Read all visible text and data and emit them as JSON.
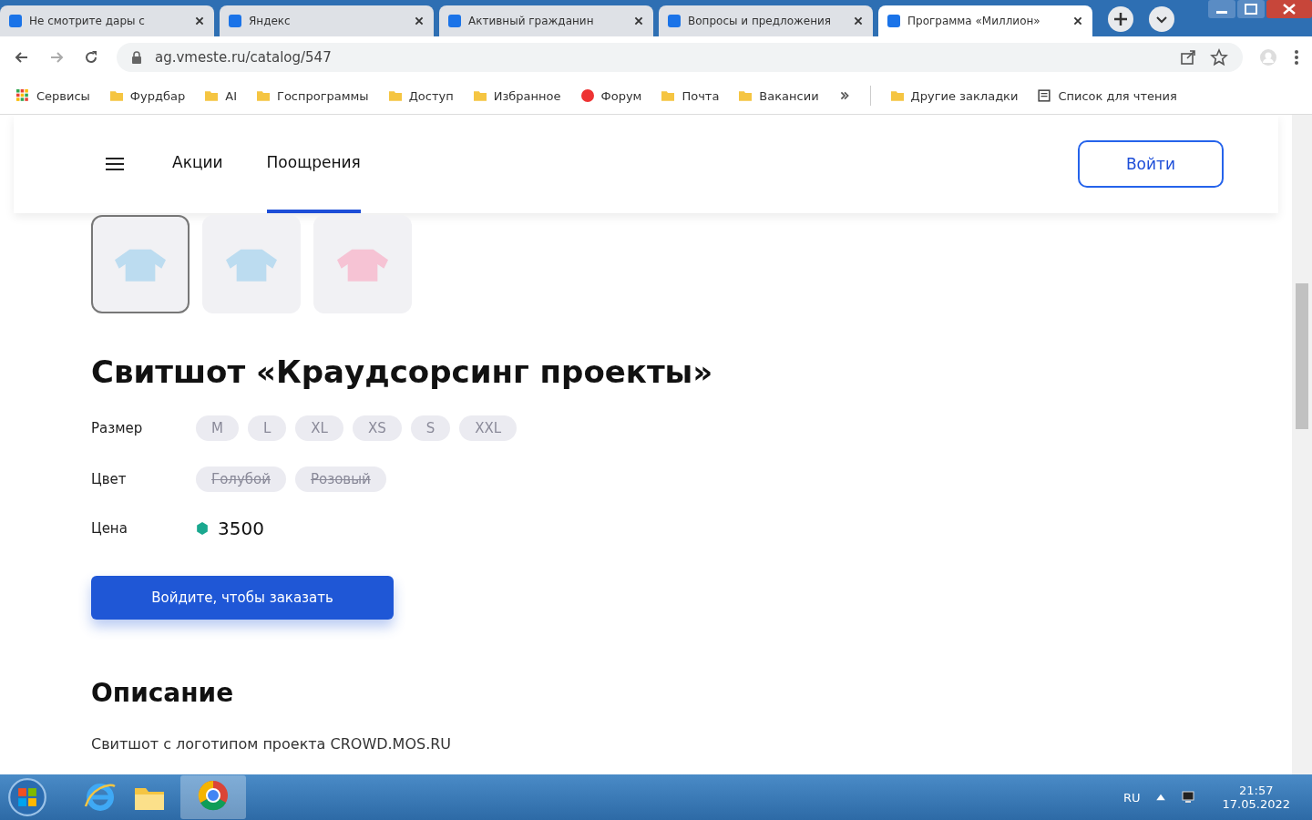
{
  "browser": {
    "tabs": [
      {
        "title": "Не смотрите дары с",
        "selected": false
      },
      {
        "title": "Яндекс",
        "selected": false
      },
      {
        "title": "Активный гражданин",
        "selected": false
      },
      {
        "title": "Вопросы и предложения",
        "selected": false
      },
      {
        "title": "Программа «Миллион»",
        "selected": true
      }
    ],
    "address": "ag.vmeste.ru/catalog/547",
    "bookmarks": [
      {
        "kind": "apps",
        "label": "Сервисы"
      },
      {
        "kind": "folder",
        "label": "Фурдбар"
      },
      {
        "kind": "folder",
        "label": "AI"
      },
      {
        "kind": "folder",
        "label": "Госпрограммы"
      },
      {
        "kind": "folder",
        "label": "Доступ"
      },
      {
        "kind": "folder",
        "label": "Избранное"
      },
      {
        "kind": "site",
        "label": "Форум"
      },
      {
        "kind": "folder",
        "label": "Почта"
      },
      {
        "kind": "folder",
        "label": "Вакансии"
      }
    ],
    "other_bookmarks": "Другие закладки",
    "reading_list": "Список для чтения"
  },
  "nav": {
    "items": [
      {
        "label": "Акции",
        "selected": false
      },
      {
        "label": "Поощрения",
        "selected": true
      }
    ],
    "login": "Войти"
  },
  "product": {
    "thumbnails": [
      {
        "color": "#bcdcf0",
        "selected": true
      },
      {
        "color": "#bcdcf0",
        "selected": false
      },
      {
        "color": "#f6c3d4",
        "selected": false
      }
    ],
    "title": "Свитшот «Краудсорсинг проекты»",
    "size_label": "Размер",
    "sizes": [
      "M",
      "L",
      "XL",
      "XS",
      "S",
      "XXL"
    ],
    "color_label": "Цвет",
    "colors": [
      {
        "label": "Голубой",
        "available": false
      },
      {
        "label": "Розовый",
        "available": false
      }
    ],
    "price_label": "Цена",
    "price": "3500",
    "order_button": "Войдите, чтобы заказать",
    "description_title": "Описание",
    "description": "Свитшот с логотипом проекта CROWD.MOS.RU"
  },
  "taskbar": {
    "language": "RU",
    "time": "21:57",
    "date": "17.05.2022"
  }
}
